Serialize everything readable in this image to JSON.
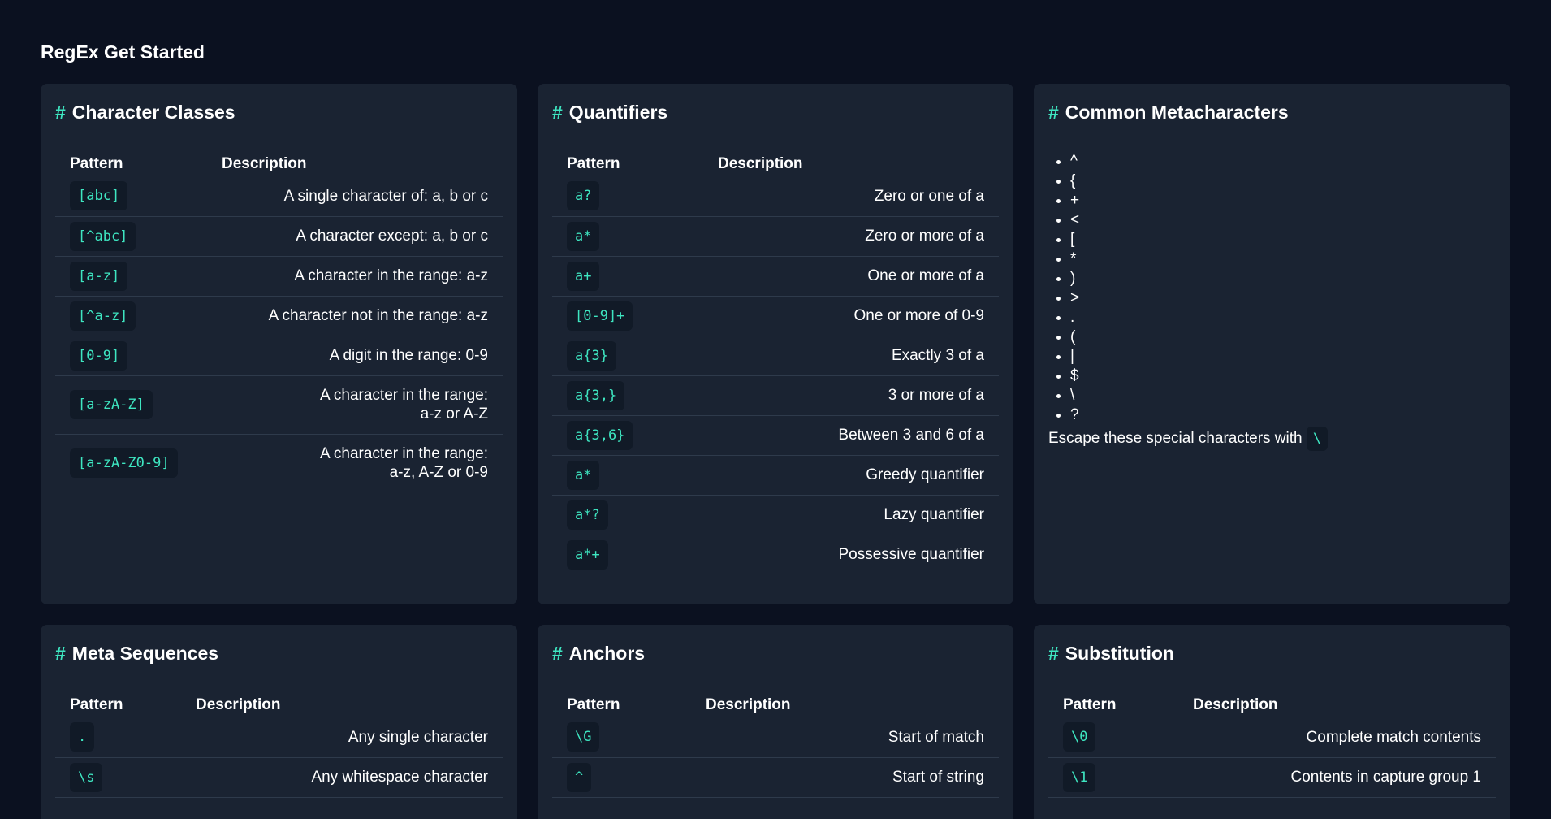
{
  "page_title": "RegEx Get Started",
  "col_pattern": "Pattern",
  "col_description": "Description",
  "character_classes": {
    "title": "Character Classes",
    "rows": [
      {
        "pattern": "[abc]",
        "description": "A single character of: a, b or c"
      },
      {
        "pattern": "[^abc]",
        "description": "A character except: a, b or c"
      },
      {
        "pattern": "[a-z]",
        "description": "A character in the range: a-z"
      },
      {
        "pattern": "[^a-z]",
        "description": "A character not in the range: a-z"
      },
      {
        "pattern": "[0-9]",
        "description": "A digit in the range: 0-9"
      },
      {
        "pattern": "[a-zA-Z]",
        "description": "A character in the range:",
        "description2": "a-z or A-Z"
      },
      {
        "pattern": "[a-zA-Z0-9]",
        "description": "A character in the range:",
        "description2": "a-z, A-Z or 0-9"
      }
    ]
  },
  "quantifiers": {
    "title": "Quantifiers",
    "rows": [
      {
        "pattern": "a?",
        "description": "Zero or one of a"
      },
      {
        "pattern": "a*",
        "description": "Zero or more of a"
      },
      {
        "pattern": "a+",
        "description": "One or more of a"
      },
      {
        "pattern": "[0-9]+",
        "description": "One or more of 0-9"
      },
      {
        "pattern": "a{3}",
        "description": "Exactly 3 of a"
      },
      {
        "pattern": "a{3,}",
        "description": "3 or more of a"
      },
      {
        "pattern": "a{3,6}",
        "description": "Between 3 and 6 of a"
      },
      {
        "pattern": "a*",
        "description": "Greedy quantifier"
      },
      {
        "pattern": "a*?",
        "description": "Lazy quantifier"
      },
      {
        "pattern": "a*+",
        "description": "Possessive quantifier"
      }
    ]
  },
  "metacharacters": {
    "title": "Common Metacharacters",
    "items": [
      "^",
      "{",
      "+",
      "<",
      "[",
      "*",
      ")",
      ">",
      ".",
      "(",
      "|",
      "$",
      "\\",
      "?"
    ],
    "escape_text": "Escape these special characters with",
    "escape_char": "\\"
  },
  "meta_sequences": {
    "title": "Meta Sequences",
    "rows": [
      {
        "pattern": ".",
        "description": "Any single character"
      },
      {
        "pattern": "\\s",
        "description": "Any whitespace character"
      }
    ]
  },
  "anchors": {
    "title": "Anchors",
    "rows": [
      {
        "pattern": "\\G",
        "description": "Start of match"
      },
      {
        "pattern": "^",
        "description": "Start of string"
      }
    ]
  },
  "substitution": {
    "title": "Substitution",
    "rows": [
      {
        "pattern": "\\0",
        "description": "Complete match contents"
      },
      {
        "pattern": "\\1",
        "description": "Contents in capture group 1"
      }
    ]
  }
}
